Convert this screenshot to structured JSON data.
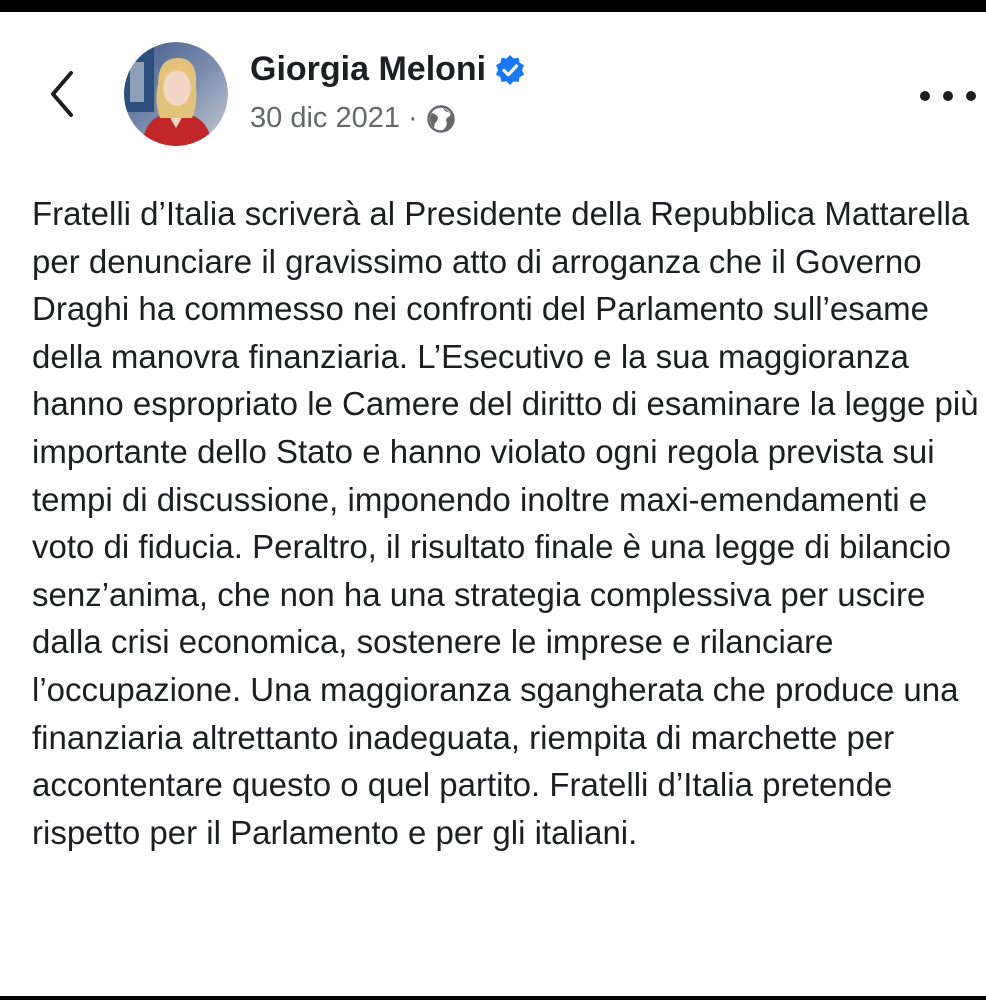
{
  "post": {
    "author": {
      "name": "Giorgia Meloni",
      "verified": true
    },
    "date": "30 dic 2021",
    "separator": "·",
    "audience_icon": "globe-icon",
    "text": "Fratelli d’Italia scriverà al Presidente della Repubblica Mattarella per denunciare il gravissimo atto di arroganza che il Governo Draghi ha commesso nei confronti del Parlamento sull’esame della manovra finanziaria. L’Esecutivo e la sua maggioranza hanno espropriato le Camere del diritto di esaminare la legge più importante dello Stato e hanno violato ogni regola prevista sui tempi di discussione, imponendo inoltre maxi-emendamenti e voto di fiducia. Peraltro, il risultato finale è una legge di bilancio senz’anima, che non ha una strategia complessiva per uscire dalla crisi economica, sostenere le imprese e rilanciare l’occupazione. Una maggioranza sgangherata che produce una finanziaria altrettanto inadeguata, riempita di marchette per accontentare questo o quel partito. Fratelli d’Italia pretende rispetto per il Parlamento e per gli italiani."
  },
  "icons": {
    "back": "chevron-left-icon",
    "verified": "verified-badge-icon",
    "more": "more-options-icon"
  },
  "colors": {
    "text": "#1c1e21",
    "secondary_text": "#65676b",
    "verified_blue": "#1877f2"
  }
}
